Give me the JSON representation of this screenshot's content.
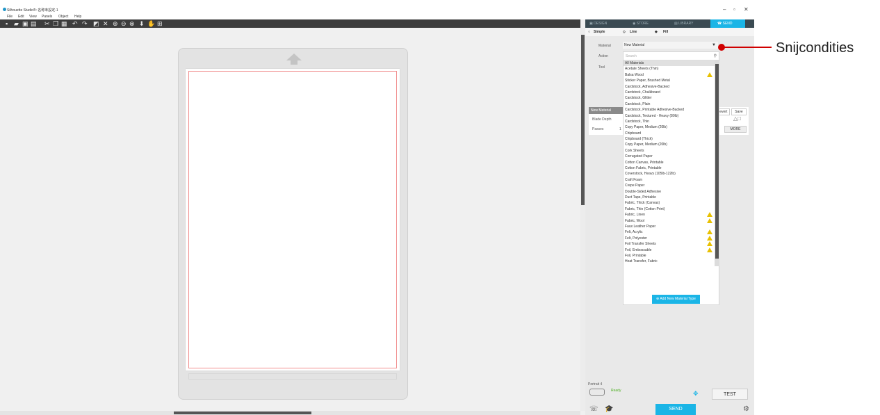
{
  "window": {
    "title": "Silhouette Studio®: 名称未設定-1",
    "min": "–",
    "max": "▫",
    "close": "✕"
  },
  "menu": [
    "File",
    "Edit",
    "View",
    "Panels",
    "Object",
    "Help"
  ],
  "tabs": [
    "DESIGN",
    "STORE",
    "LIBRARY",
    "SEND"
  ],
  "modes": [
    "Simple",
    "Line",
    "Fill"
  ],
  "settings": {
    "material_label": "Material",
    "material_value": "New Material",
    "action_label": "Action",
    "tool_label": "Tool"
  },
  "search_placeholder": "Search",
  "materials": [
    {
      "name": "All Materials",
      "warn": false
    },
    {
      "name": "Acetate Sheets (Thin)",
      "warn": false
    },
    {
      "name": "Balsa Wood",
      "warn": true
    },
    {
      "name": "Sticker Paper, Brushed Metal",
      "warn": false
    },
    {
      "name": "Cardstock, Adhesive-Backed",
      "warn": false
    },
    {
      "name": "Cardstock, Chalkboard",
      "warn": false
    },
    {
      "name": "Cardstock, Glitter",
      "warn": false
    },
    {
      "name": "Cardstock, Plain",
      "warn": false
    },
    {
      "name": "Cardstock, Printable Adhesive-Backed",
      "warn": false
    },
    {
      "name": "Cardstock, Textured - Heavy (80lb)",
      "warn": false
    },
    {
      "name": "Cardstock, Thin",
      "warn": false
    },
    {
      "name": "Copy Paper, Medium (20lb)",
      "warn": false
    },
    {
      "name": "Chipboard",
      "warn": false
    },
    {
      "name": "Chipboard (Thick)",
      "warn": false
    },
    {
      "name": "Copy Paper, Medium (20lb)",
      "warn": false
    },
    {
      "name": "Cork Sheets",
      "warn": false
    },
    {
      "name": "Corrugated Paper",
      "warn": false
    },
    {
      "name": "Cotton Canvas, Printable",
      "warn": false
    },
    {
      "name": "Cotton Fabric, Printable",
      "warn": false
    },
    {
      "name": "Coverstock, Heavy (105lb-122lb)",
      "warn": false
    },
    {
      "name": "Craft Foam",
      "warn": false
    },
    {
      "name": "Crepe Paper",
      "warn": false
    },
    {
      "name": "Double-Sided Adhesive",
      "warn": false
    },
    {
      "name": "Duct Tape, Printable",
      "warn": false
    },
    {
      "name": "Fabric, Thick (Canvas)",
      "warn": false
    },
    {
      "name": "Fabric, Thin (Cotton Print)",
      "warn": false
    },
    {
      "name": "Fabric, Linen",
      "warn": true
    },
    {
      "name": "Fabric, Wool",
      "warn": true
    },
    {
      "name": "Faux Leather Paper",
      "warn": false
    },
    {
      "name": "Felt, Acrylic",
      "warn": true
    },
    {
      "name": "Felt, Polyester",
      "warn": true
    },
    {
      "name": "Foil Transfer Sheets",
      "warn": true
    },
    {
      "name": "Foil, Embossable",
      "warn": true
    },
    {
      "name": "Foil, Printable",
      "warn": false
    },
    {
      "name": "Heat Transfer, Fabric",
      "warn": false
    }
  ],
  "add_button": "Add New Material Type",
  "side": {
    "header": "New Material",
    "blade_depth": "Blade Depth",
    "passes": "Passes",
    "passes_value": "1",
    "revert": "Revert",
    "save": "Save",
    "more": "MORE"
  },
  "device": {
    "name": "Portrait 4",
    "status": "Ready"
  },
  "buttons": {
    "test": "TEST",
    "send": "SEND"
  },
  "annotation": "Snijcondities"
}
